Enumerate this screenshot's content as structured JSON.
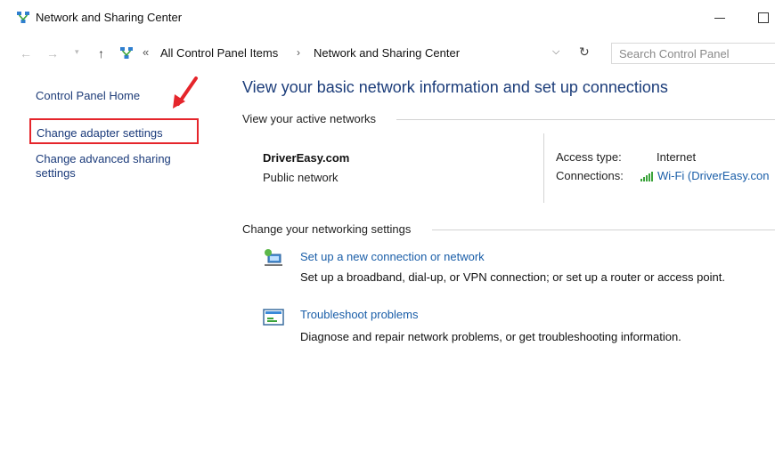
{
  "window": {
    "title": "Network and Sharing Center"
  },
  "navigation": {
    "back_icon": "back-arrow-icon",
    "forward_icon": "forward-arrow-icon",
    "up_icon": "up-arrow-icon",
    "overflow": "«",
    "breadcrumbs": [
      "All Control Panel Items",
      "Network and Sharing Center"
    ],
    "search_placeholder": "Search Control Panel"
  },
  "sidebar": {
    "home": "Control Panel Home",
    "items": [
      "Change adapter settings",
      "Change advanced sharing settings"
    ],
    "highlight_color": "#e5252b"
  },
  "main": {
    "title": "View your basic network information and set up connections",
    "active_networks_header": "View your active networks",
    "network": {
      "name": "DriverEasy.com",
      "type": "Public network",
      "access_type_label": "Access type:",
      "access_type_value": "Internet",
      "connections_label": "Connections:",
      "connections_value": "Wi-Fi (DriverEasy.con"
    },
    "change_settings_header": "Change your networking settings",
    "tasks": [
      {
        "link": "Set up a new connection or network",
        "description": "Set up a broadband, dial-up, or VPN connection; or set up a router or access point.",
        "icon": "network-setup-icon"
      },
      {
        "link": "Troubleshoot problems",
        "description": "Diagnose and repair network problems, or get troubleshooting information.",
        "icon": "troubleshoot-icon"
      }
    ]
  },
  "colors": {
    "title_blue": "#1c3d7a",
    "link_blue": "#1a5ea8",
    "annotation_red": "#e5252b"
  }
}
